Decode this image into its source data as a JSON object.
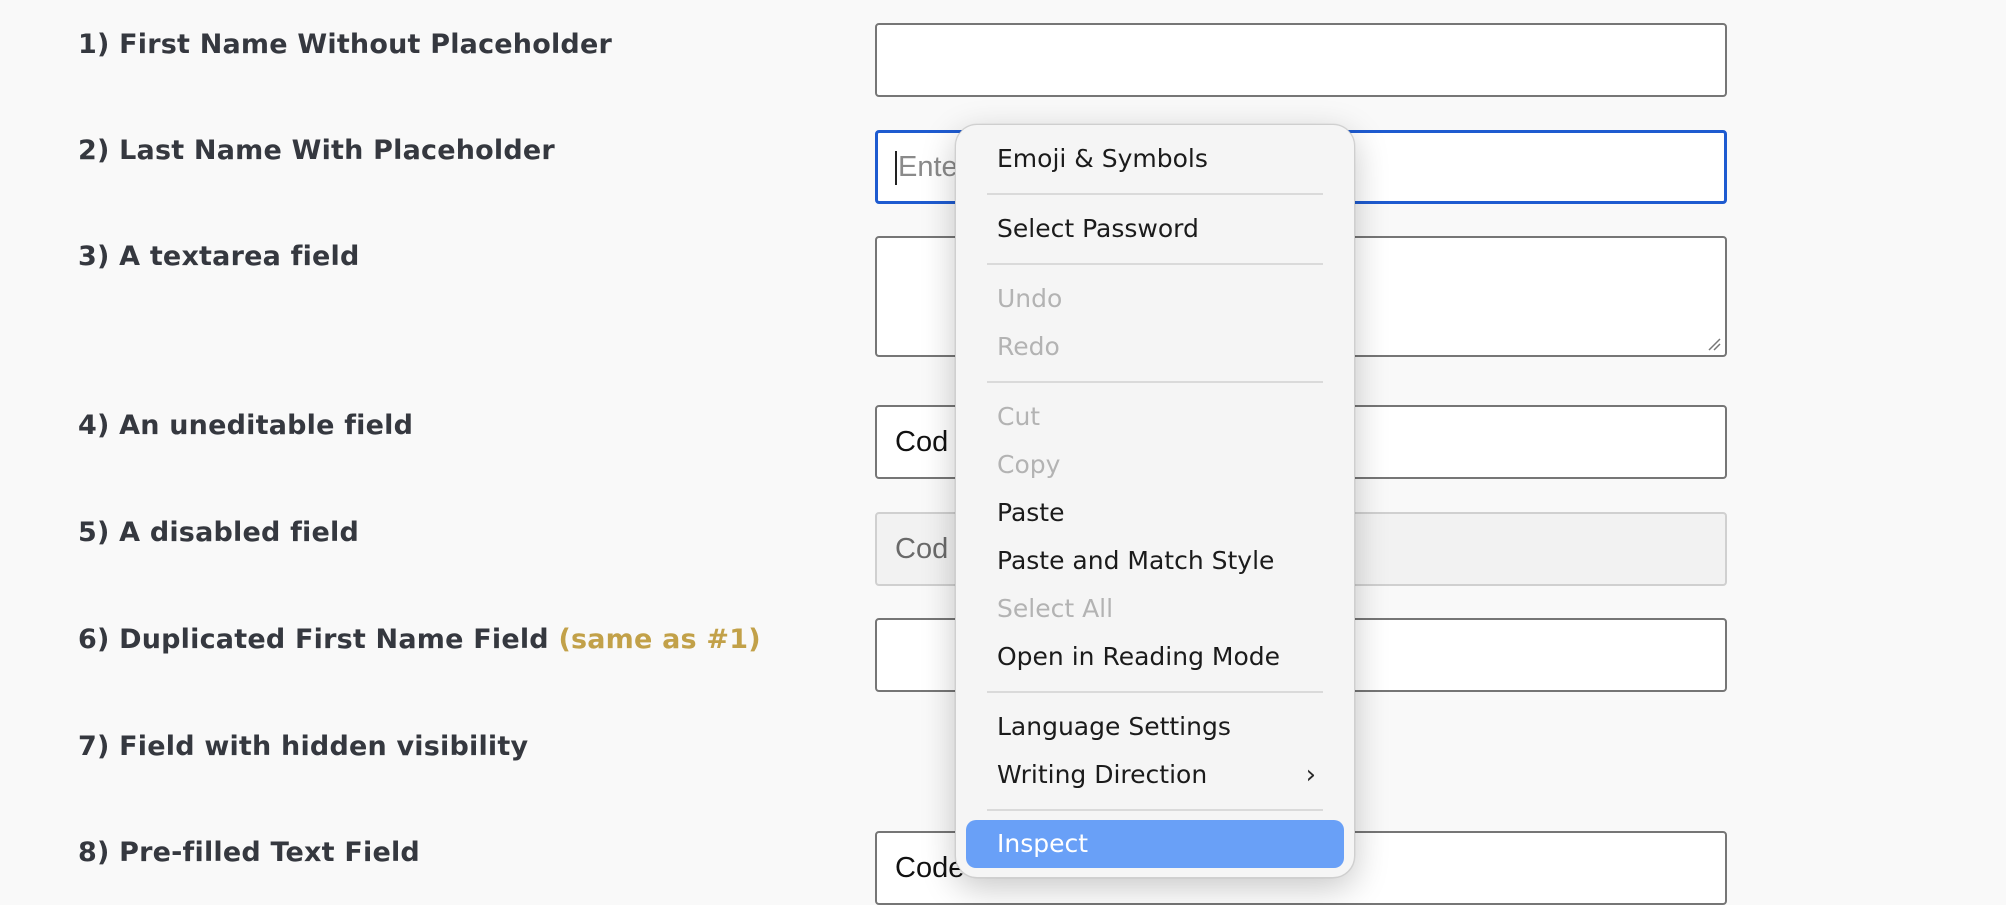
{
  "form": {
    "labels": {
      "l1": "1) First Name Without Placeholder",
      "l2": "2) Last Name With Placeholder",
      "l3": "3) A textarea field",
      "l4": "4) An uneditable field",
      "l5": "5) A disabled field",
      "l6": "6) Duplicated First Name Field",
      "l6_note": "(same as #1)",
      "l7": "7) Field with hidden visibility",
      "l8": "8) Pre-filled Text Field"
    },
    "fields": {
      "last_name_visible": "Ente",
      "uneditable_visible": "Cod",
      "disabled_visible": "Cod",
      "prefilled_visible": "Code"
    }
  },
  "context_menu": {
    "items": [
      {
        "label": "Emoji & Symbols",
        "state": "enabled"
      },
      {
        "label": "Select Password",
        "state": "enabled"
      },
      {
        "label": "Undo",
        "state": "disabled"
      },
      {
        "label": "Redo",
        "state": "disabled"
      },
      {
        "label": "Cut",
        "state": "disabled"
      },
      {
        "label": "Copy",
        "state": "disabled"
      },
      {
        "label": "Paste",
        "state": "enabled"
      },
      {
        "label": "Paste and Match Style",
        "state": "enabled"
      },
      {
        "label": "Select All",
        "state": "disabled"
      },
      {
        "label": "Open in Reading Mode",
        "state": "enabled"
      },
      {
        "label": "Language Settings",
        "state": "enabled"
      },
      {
        "label": "Writing Direction",
        "state": "enabled",
        "submenu": true
      },
      {
        "label": "Inspect",
        "state": "highlighted"
      }
    ]
  },
  "colors": {
    "label_text": "#35383f",
    "accent": "#c2a149",
    "focus_border": "#1e5bd0",
    "menu_highlight": "#69a0f7"
  }
}
